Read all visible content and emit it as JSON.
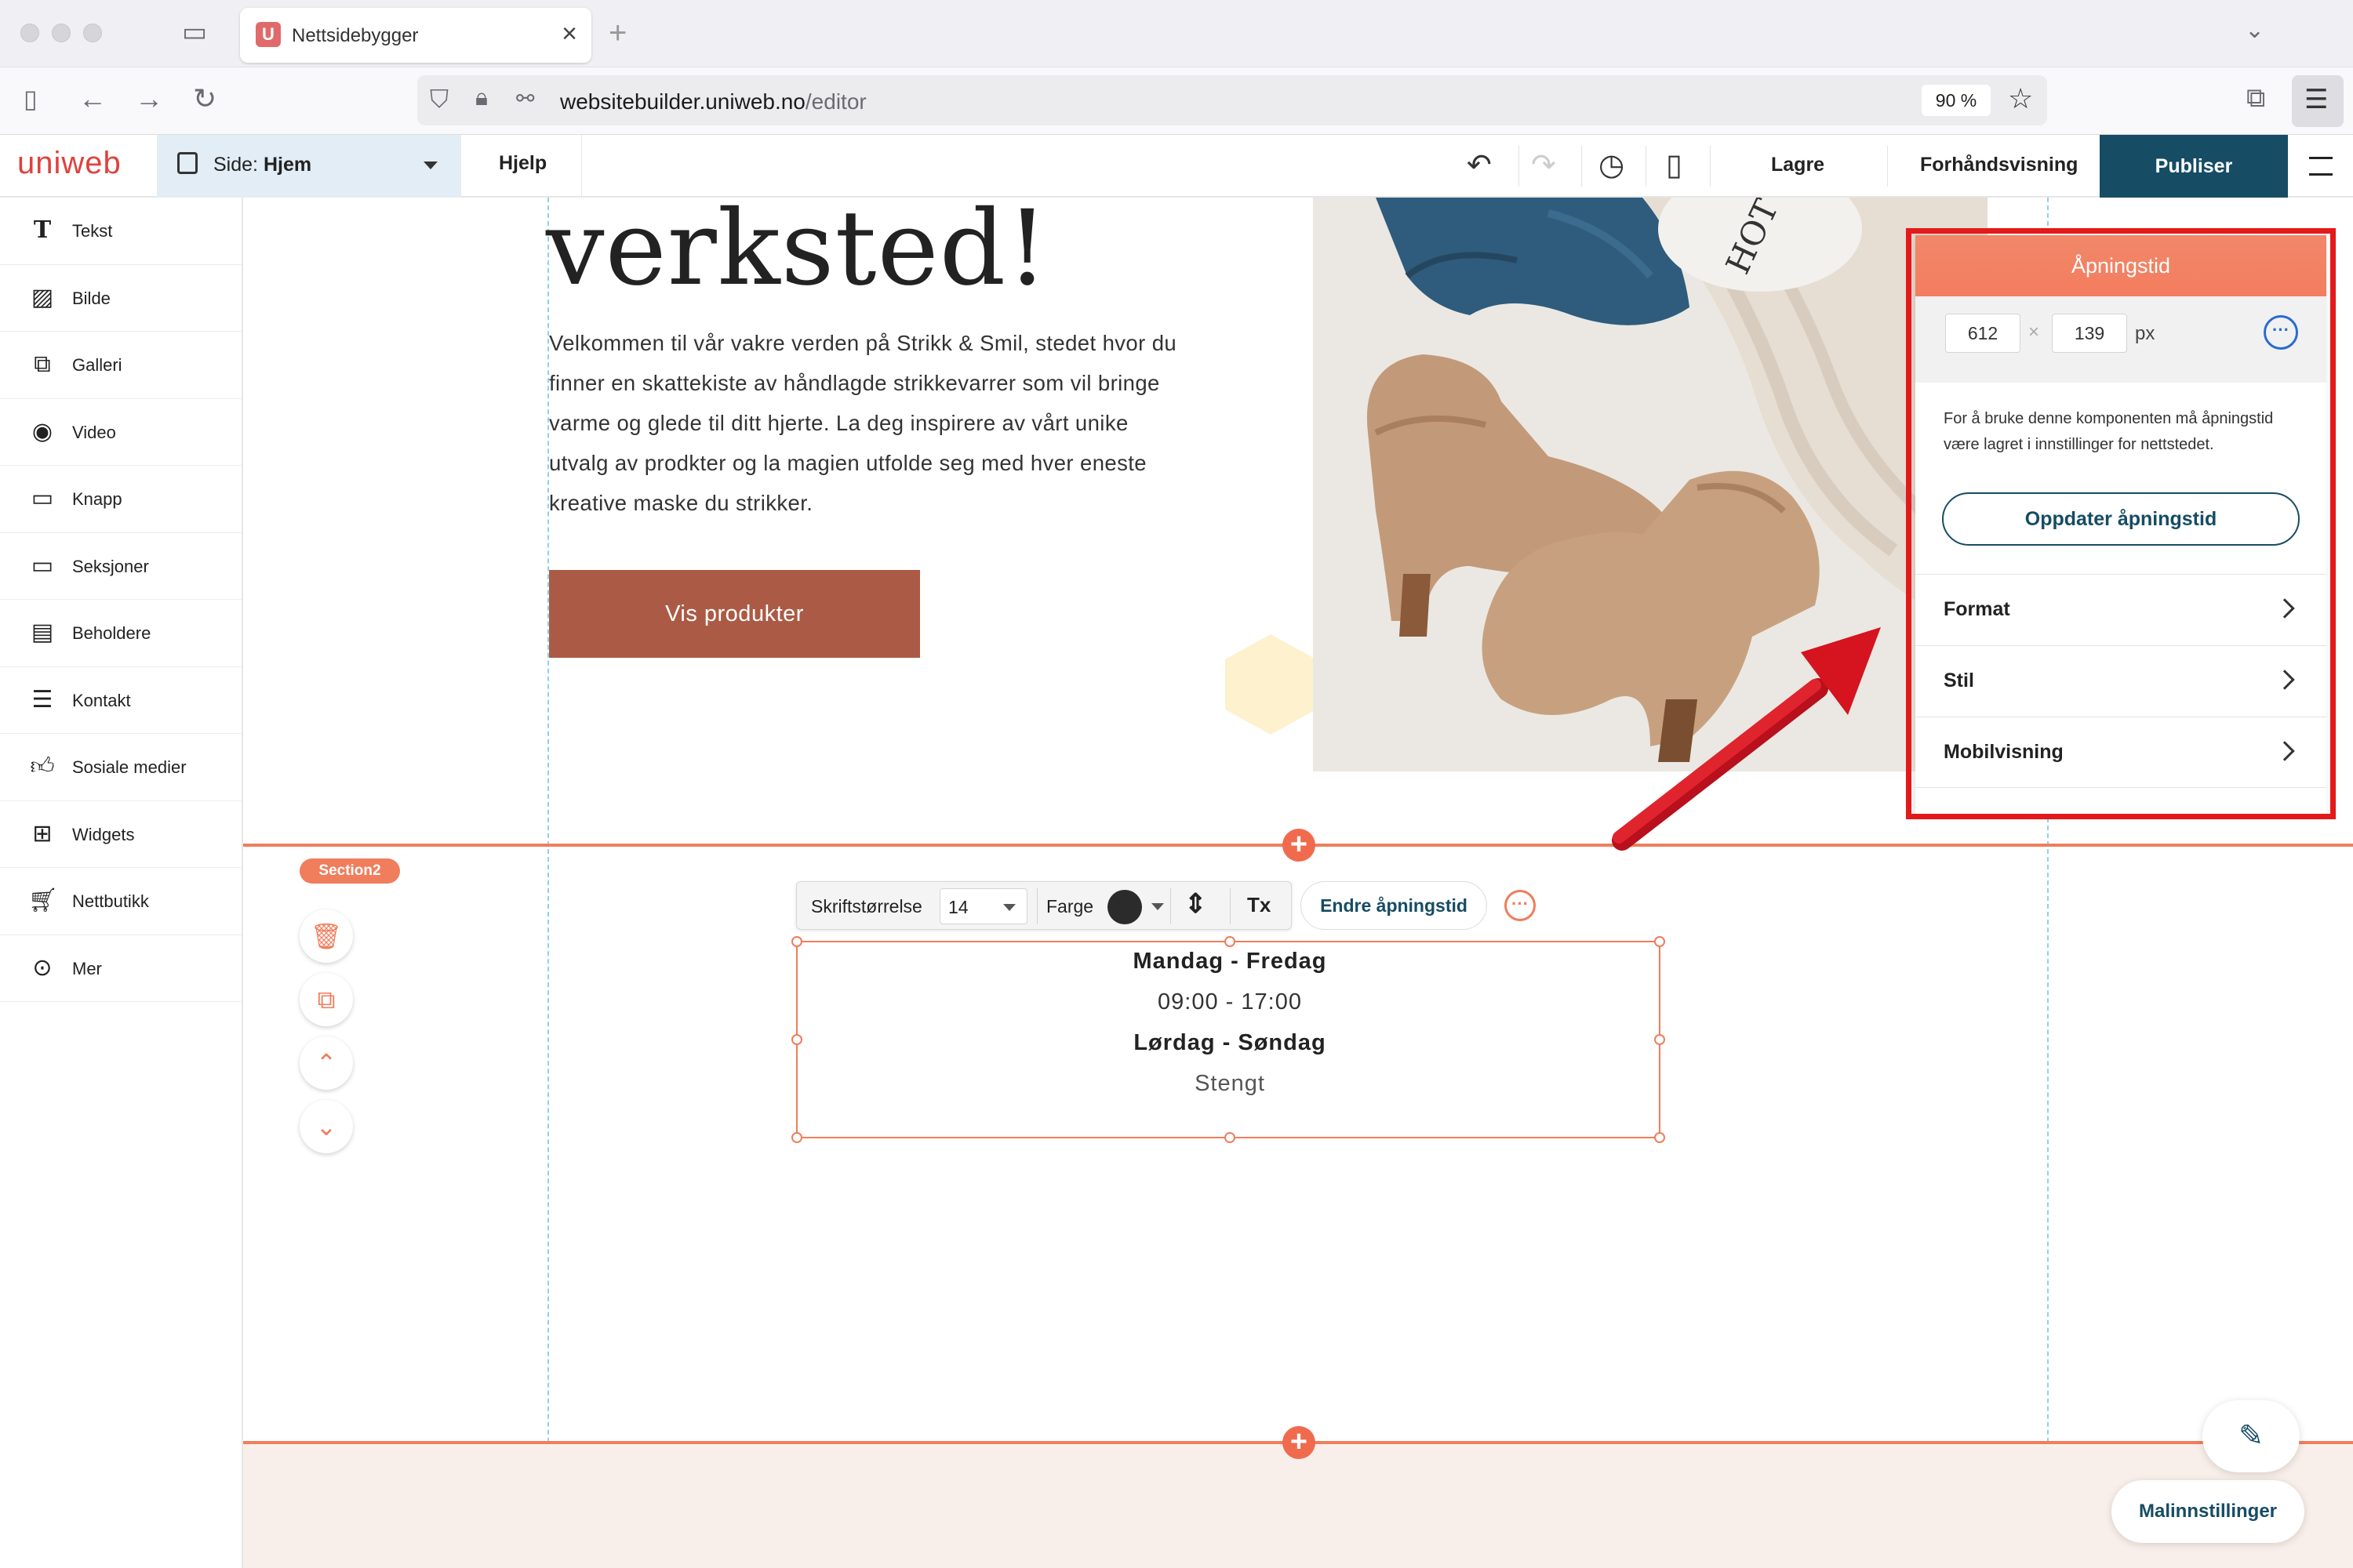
{
  "browser": {
    "tab_title": "Nettsidebygger",
    "tab_favicon": "U",
    "url_host": "websitebuilder.uniweb.no",
    "url_path": "/editor",
    "zoom": "90 %"
  },
  "editor": {
    "logo": "uniweb",
    "page_prefix": "Side:",
    "page_name": "Hjem",
    "help": "Hjelp",
    "save": "Lagre",
    "preview": "Forhåndsvisning",
    "publish": "Publiser"
  },
  "sidebar": {
    "items": [
      {
        "label": "Tekst",
        "icon": "text-icon"
      },
      {
        "label": "Bilde",
        "icon": "image-icon"
      },
      {
        "label": "Galleri",
        "icon": "gallery-icon"
      },
      {
        "label": "Video",
        "icon": "video-icon"
      },
      {
        "label": "Knapp",
        "icon": "button-icon"
      },
      {
        "label": "Seksjoner",
        "icon": "section-icon"
      },
      {
        "label": "Beholdere",
        "icon": "container-icon"
      },
      {
        "label": "Kontakt",
        "icon": "contact-icon"
      },
      {
        "label": "Sosiale medier",
        "icon": "thumbs-up-icon"
      },
      {
        "label": "Widgets",
        "icon": "widgets-icon"
      },
      {
        "label": "Nettbutikk",
        "icon": "cart-icon"
      },
      {
        "label": "Mer",
        "icon": "more-icon"
      }
    ]
  },
  "hero": {
    "heading": "verksted!",
    "body_lines": [
      "Velkommen til vår vakre verden på Strikk & Smil, stedet hvor du",
      "finner en skattekiste av håndlagde strikkevarrer som vil bringe",
      "varme og glede til ditt hjerte. La deg inspirere av vårt unike",
      "utvalg av prodkter og la magien utfolde seg med hver eneste",
      "kreative maske du strikker."
    ],
    "button": "Vis produkter",
    "photo_mug_text": "HOT MESS"
  },
  "section": {
    "tag": "Section2"
  },
  "format_toolbar": {
    "font_size_label": "Skriftstørrelse",
    "font_size_value": "14",
    "color_label": "Farge",
    "clear_format_glyph": "Tx",
    "edit_hours": "Endre åpningstid"
  },
  "hours": {
    "line1": "Mandag - Fredag",
    "line2": "09:00 - 17:00",
    "line3": "Lørdag - Søndag",
    "line4": "Stengt"
  },
  "panel": {
    "title": "Åpningstid",
    "width": "612",
    "height": "139",
    "unit": "px",
    "note": "For å bruke denne komponenten må åpningstid være lagret i innstillinger for nettstedet.",
    "update_button": "Oppdater åpningstid",
    "rows": [
      "Format",
      "Stil",
      "Mobilvisning"
    ]
  },
  "floating": {
    "template_settings": "Malinnstillinger"
  },
  "colors": {
    "accent": "#f07d5c",
    "publish_bg": "#164c64",
    "hero_button": "#ab5b45",
    "highlight_outline": "#e41a1a"
  }
}
